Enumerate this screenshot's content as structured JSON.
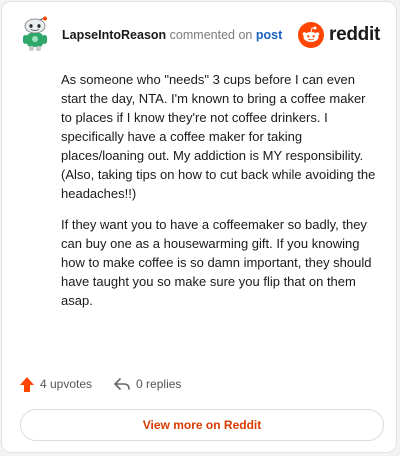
{
  "header": {
    "username": "LapseIntoReason",
    "verb": "commented on",
    "post_link": "post",
    "brand": "reddit"
  },
  "comment": {
    "paragraphs": [
      "As someone who \"needs\" 3 cups before I can even start the day, NTA. I'm known to bring a coffee maker to places if I know they're not coffee drinkers. I specifically have a coffee maker for taking places/loaning out. My addiction is MY responsibility. (Also, taking tips on how to cut back while avoiding the headaches!!)",
      "If they want you to have a coffeemaker so badly, they can buy one as a housewarming gift. If you knowing how to make coffee is so damn important, they should have taught you so make sure you flip that on them asap."
    ]
  },
  "actions": {
    "upvotes": "4 upvotes",
    "replies": "0 replies"
  },
  "footer": {
    "view_more": "View more on Reddit"
  },
  "colors": {
    "brand_orange": "#ff4500",
    "link_blue": "#1a61c2",
    "cta_orange": "#d93a00"
  }
}
